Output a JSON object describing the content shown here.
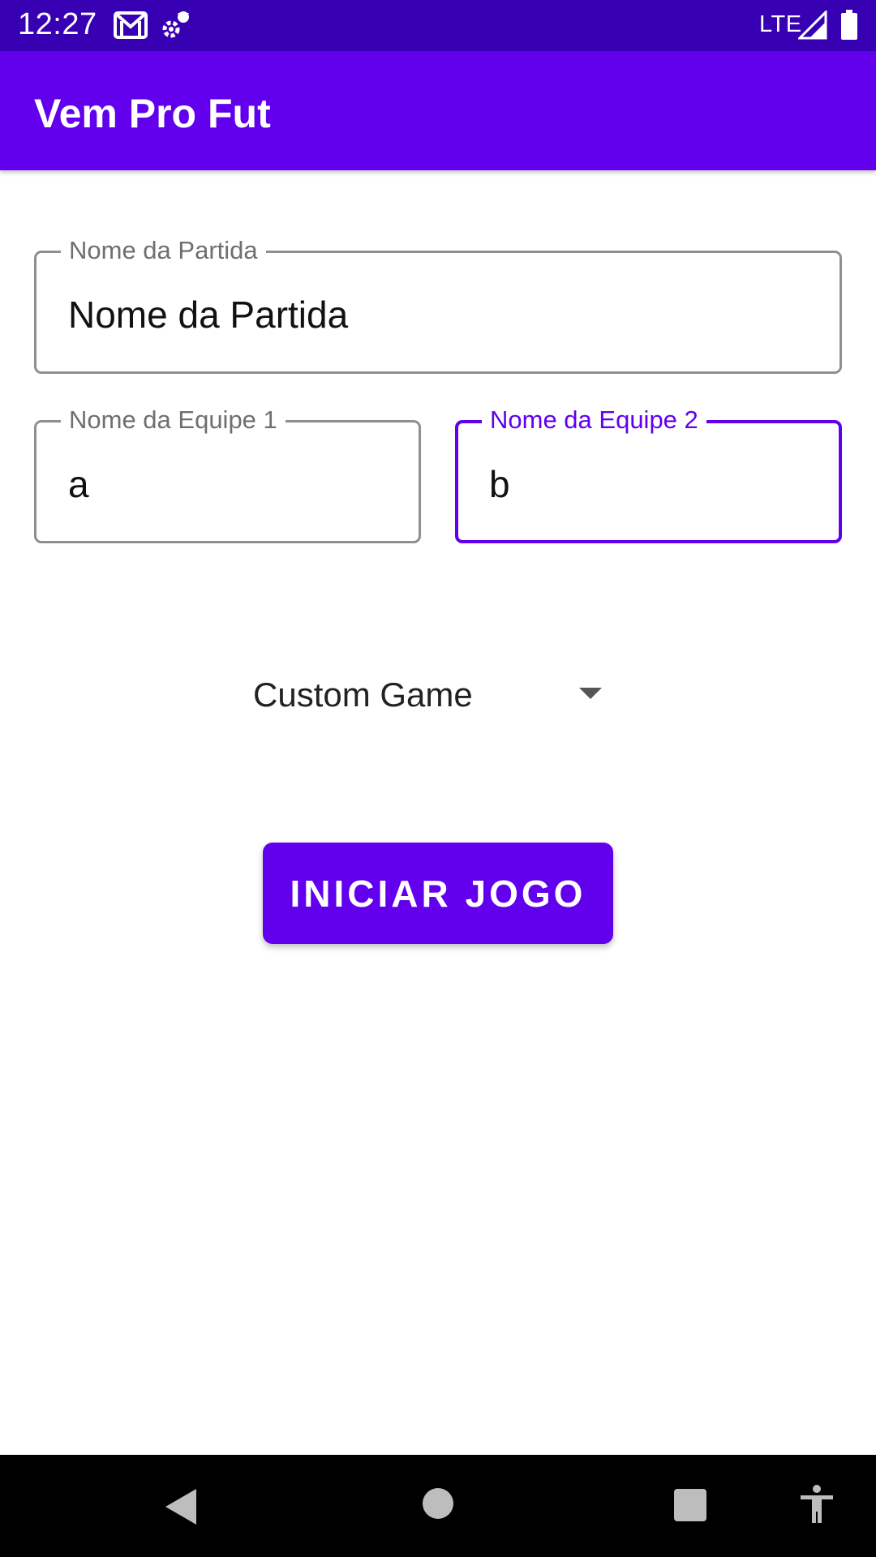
{
  "status_bar": {
    "time": "12:27",
    "network": "LTE",
    "icons": [
      "gmail-icon",
      "sync-icon",
      "signal-icon",
      "battery-icon"
    ]
  },
  "app_bar": {
    "title": "Vem Pro Fut"
  },
  "form": {
    "match_name": {
      "label": "Nome da Partida",
      "value": "Nome da Partida"
    },
    "team1": {
      "label": "Nome da Equipe 1",
      "value": "a"
    },
    "team2": {
      "label": "Nome da Equipe 2",
      "value": "b",
      "focused": true
    },
    "game_mode": {
      "selected": "Custom Game"
    },
    "start_button": {
      "label": "INICIAR JOGO"
    }
  },
  "nav_bar": {
    "icons": [
      "back-icon",
      "home-icon",
      "recents-icon",
      "accessibility-icon"
    ]
  },
  "colors": {
    "primary": "#6200ee",
    "primary_dark": "#3700b3",
    "outline": "#8f8f8f",
    "nav_background": "#000000"
  }
}
